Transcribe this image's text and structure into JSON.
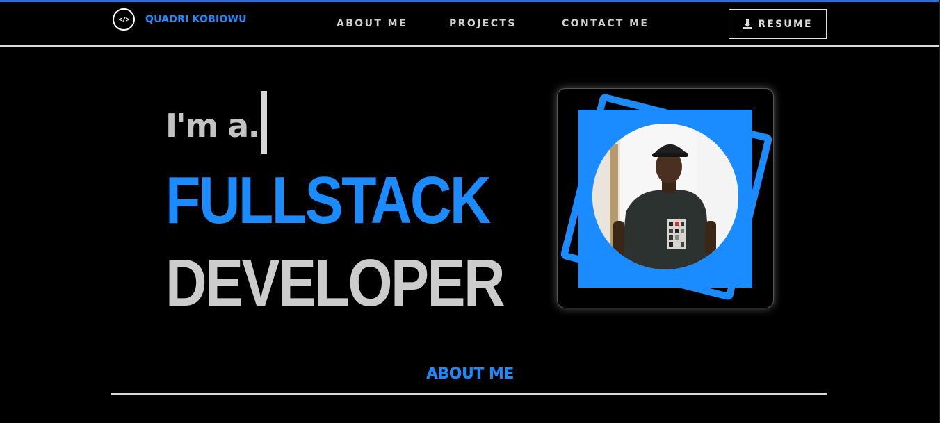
{
  "brand": {
    "icon": "code-icon",
    "icon_text": "</>",
    "name": "QUADRI KOBIOWU"
  },
  "nav": {
    "items": [
      {
        "label": "ABOUT ME"
      },
      {
        "label": "PROJECTS"
      },
      {
        "label": "CONTACT ME"
      }
    ],
    "resume_label": "RESUME",
    "resume_icon": "download-icon"
  },
  "hero": {
    "intro": "I'm a.",
    "line1": "FULLSTACK",
    "line2": "DEVELOPER",
    "photo_icon": "profile-photo"
  },
  "about": {
    "title": "ABOUT ME"
  },
  "colors": {
    "accent": "#1a8cff",
    "background": "#000000",
    "text_light": "#cccccc",
    "top_bar": "#2b6fd6"
  }
}
